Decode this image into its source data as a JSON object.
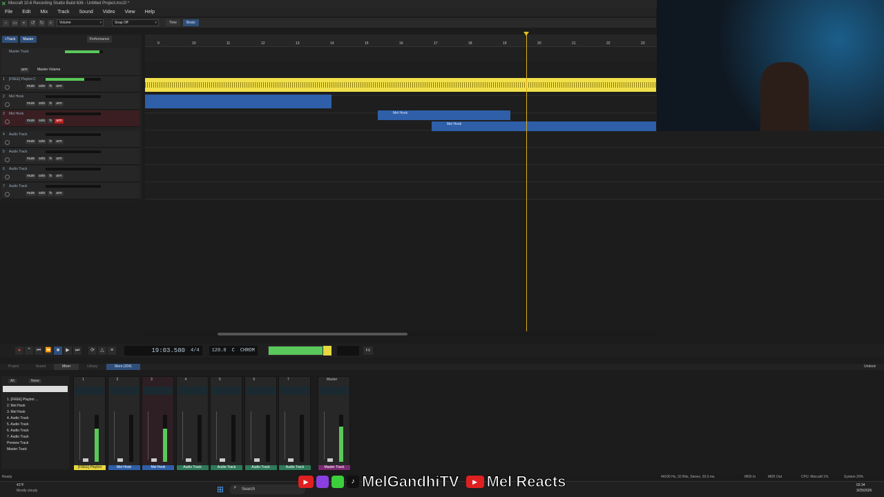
{
  "window": {
    "title": "Mixcraft 10.6 Recording Studio Build 636 - Untitled Project.mx10 *"
  },
  "menu": [
    "File",
    "Edit",
    "Mix",
    "Track",
    "Sound",
    "Video",
    "View",
    "Help"
  ],
  "toolbar": {
    "param_select": "Volume",
    "snap_select": "Snap Off",
    "time_label": "Time",
    "beats_label": "Beats"
  },
  "panel": {
    "add_track": "+Track",
    "master_btn": "Master",
    "performance_btn": "Performance",
    "master_track_label": "Master Track",
    "master_volume_label": "Master Volume",
    "arm_label": "arm"
  },
  "tracks": [
    {
      "num": "1",
      "name": "[FREE] Playboi C",
      "armed": false
    },
    {
      "num": "2",
      "name": "Mel Hook",
      "armed": false
    },
    {
      "num": "3",
      "name": "Mel Hook",
      "armed": true
    },
    {
      "num": "4",
      "name": "Audio Track",
      "armed": false
    },
    {
      "num": "5",
      "name": "Audio Track",
      "armed": false
    },
    {
      "num": "6",
      "name": "Audio Track",
      "armed": false
    },
    {
      "num": "7",
      "name": "Audio Track",
      "armed": false
    }
  ],
  "track_controls": {
    "mute": "mute",
    "solo": "solo",
    "fx": "fx",
    "arm": "arm"
  },
  "ruler": {
    "ticks": [
      "9",
      "10",
      "11",
      "12",
      "13",
      "14",
      "15",
      "16",
      "17",
      "18",
      "19",
      "20",
      "21",
      "22",
      "23"
    ]
  },
  "clips": {
    "clip_a": "Mel Hook",
    "clip_b": "Mel Hook"
  },
  "transport": {
    "time": "19:03.580",
    "signature": "4/4",
    "tempo": "120.0",
    "key": "C",
    "mode": "CHROM",
    "fx": "FX"
  },
  "tabs": [
    "Project",
    "Sound",
    "Mixer",
    "Library",
    "Store (204)"
  ],
  "mixer_left": {
    "all": "All",
    "none": "None",
    "items": [
      "1. [FREE] Playboi ...",
      "2. Mel Hook",
      "3. Mel Hook",
      "4. Audio Track",
      "5. Audio Track",
      "6. Audio Track",
      "7. Audio Track",
      "Preview Track",
      "Master Track"
    ]
  },
  "mixer_strips": [
    {
      "num": "1",
      "label": "[FREE] Playboi"
    },
    {
      "num": "2",
      "label": "Mel Hook"
    },
    {
      "num": "3",
      "label": "Mel Hook"
    },
    {
      "num": "4",
      "label": "Audio Track"
    },
    {
      "num": "5",
      "label": "Audio Track"
    },
    {
      "num": "6",
      "label": "Audio Track"
    },
    {
      "num": "7",
      "label": "Audio Track"
    }
  ],
  "master_strip": {
    "title": "Master",
    "label": "Master Track"
  },
  "undock": "Undock",
  "status": {
    "ready": "Ready",
    "format": "44100 Hz, 32 Bits, Stereo, 20.0 ms",
    "midi_in": "MIDI In",
    "midi_out": "MIDI Out",
    "cpu": "CPU: Mixcraft 1%",
    "system": "System 20%"
  },
  "taskbar": {
    "weather_temp": "41°F",
    "weather_desc": "Mostly cloudy",
    "search": "Search",
    "time": "02:34",
    "date": "3/25/2026"
  },
  "overlay": {
    "channel_a": "MelGandhiTV",
    "channel_b": "Mel Reacts"
  },
  "colors": {
    "accent": "#2f4f7a",
    "yellow_clip": "#f2e04a",
    "blue_clip": "#2e5fa8",
    "arm_red": "#b62020",
    "meter_green": "#5ac85a"
  }
}
